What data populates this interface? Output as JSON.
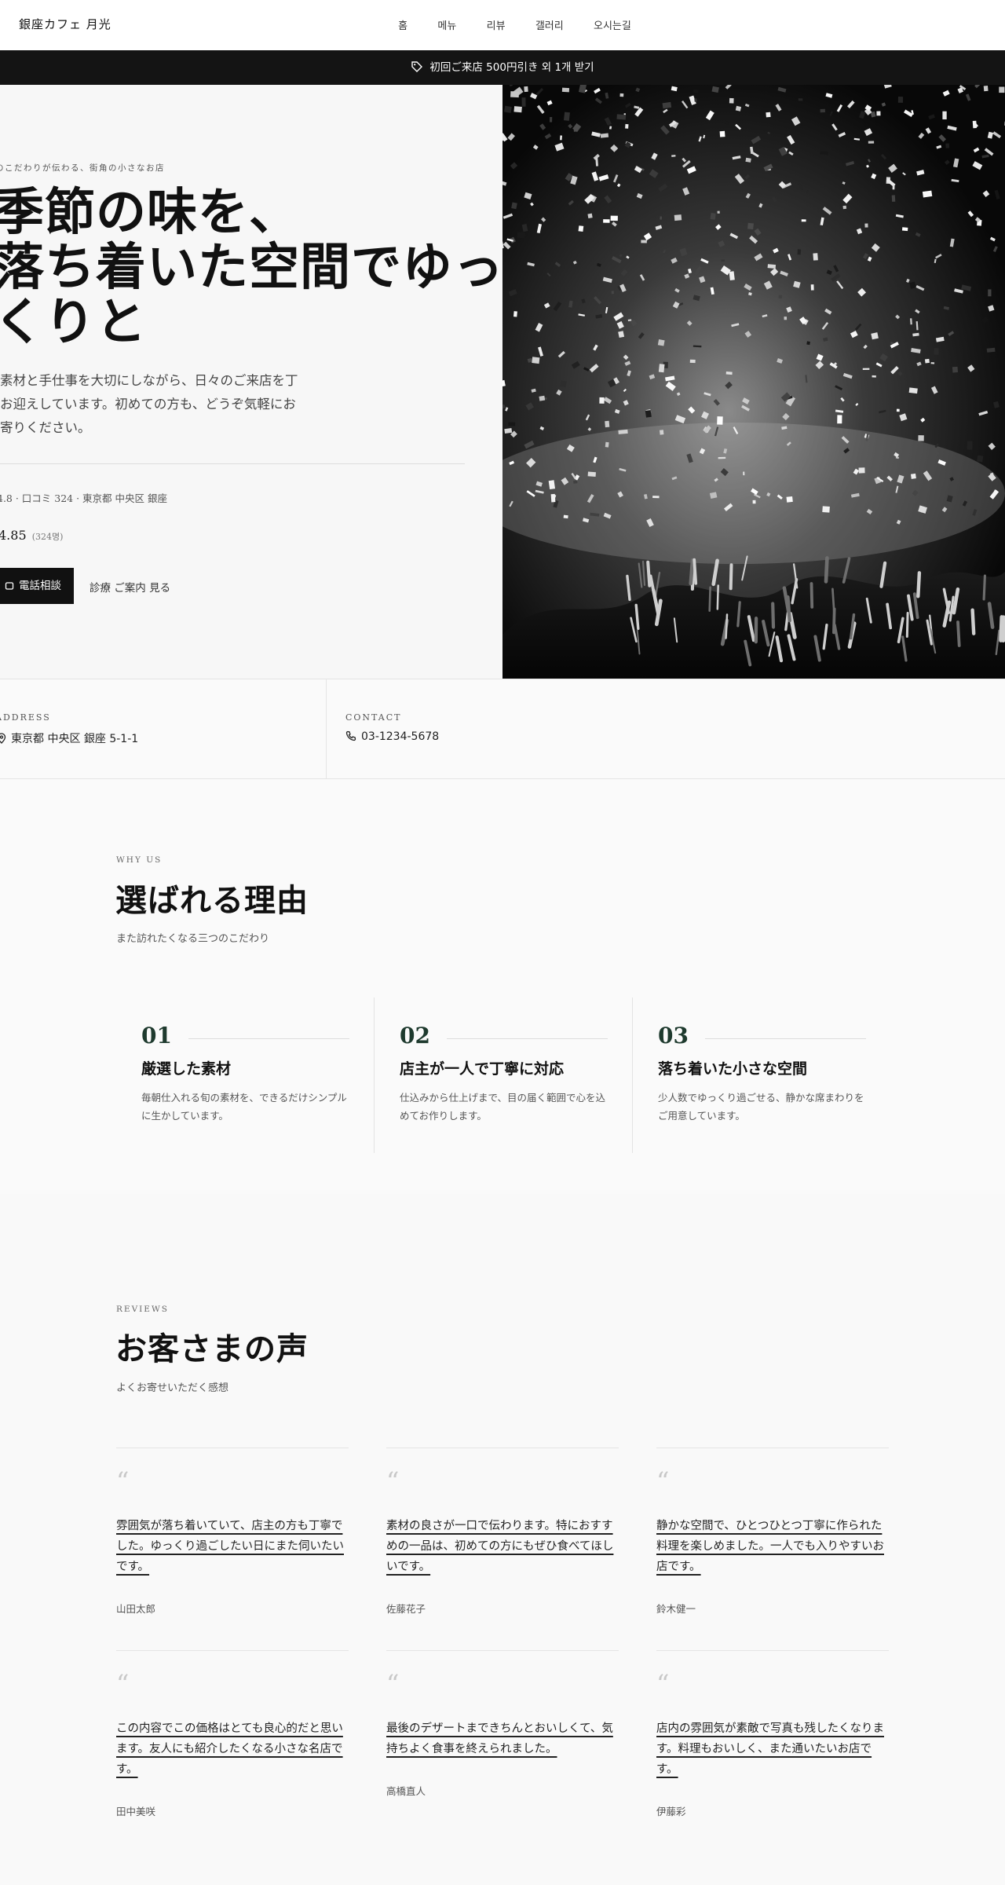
{
  "header": {
    "brand": "銀座カフェ 月光",
    "nav": [
      "홈",
      "메뉴",
      "리뷰",
      "갤러리",
      "오시는길"
    ]
  },
  "announce": {
    "text": "初回ご来店 500円引き 외 1개 받기",
    "icon": "tag-icon"
  },
  "hero": {
    "eyebrow": "のこだわりが伝わる、街角の小さなお店",
    "title_lines": [
      "季節の味を、",
      "落ち着いた空間でゆっ",
      "くりと"
    ],
    "desc_lines": [
      "素材と手仕事を大切にしながら、日々のご来店を丁",
      "お迎えしています。初めての方も、どうぞ気軽にお",
      "寄りください。"
    ],
    "meta": "4.8 · 口コミ 324 · 東京都 中央区 銀座",
    "rating": "4.85",
    "rating_count": "(324명)",
    "call_button": "電話相談",
    "hours_link": "診療 ご案内 見る",
    "image_alt": "confetti concert crowd photo"
  },
  "info": {
    "address_label": "ADDRESS",
    "address_value": "東京都 中央区 銀座 5-1-1",
    "contact_label": "CONTACT",
    "contact_value": "03-1234-5678"
  },
  "why": {
    "eyebrow": "WHY US",
    "title": "選ばれる理由",
    "subtitle": "また訪れたくなる三つのこだわり",
    "features": [
      {
        "num": "01",
        "title": "厳選した素材",
        "text": "毎朝仕入れる旬の素材を、できるだけシンプルに生かしています。"
      },
      {
        "num": "02",
        "title": "店主が一人で丁寧に対応",
        "text": "仕込みから仕上げまで、目の届く範囲で心を込めてお作りします。"
      },
      {
        "num": "03",
        "title": "落ち着いた小さな空間",
        "text": "少人数でゆっくり過ごせる、静かな席まわりをご用意しています。"
      }
    ]
  },
  "reviews": {
    "eyebrow": "REVIEWS",
    "title": "お客さまの声",
    "subtitle": "よくお寄せいただく感想",
    "quote_mark": "“",
    "items": [
      {
        "text": "雰囲気が落ち着いていて、店主の方も丁寧でした。ゆっくり過ごしたい日にまた伺いたいです。",
        "author": "山田太郎"
      },
      {
        "text": "素材の良さが一口で伝わります。特におすすめの一品は、初めての方にもぜひ食べてほしいです。",
        "author": "佐藤花子"
      },
      {
        "text": "静かな空間で、ひとつひとつ丁寧に作られた料理を楽しめました。一人でも入りやすいお店です。",
        "author": "鈴木健一"
      },
      {
        "text": "この内容でこの価格はとても良心的だと思います。友人にも紹介したくなる小さな名店です。",
        "author": "田中美咲"
      },
      {
        "text": "最後のデザートまできちんとおいしくて、気持ちよく食事を終えられました。",
        "author": "高橋直人"
      },
      {
        "text": "店内の雰囲気が素敵で写真も残したくなります。料理もおいしく、また通いたいお店です。",
        "author": "伊藤彩"
      }
    ]
  }
}
